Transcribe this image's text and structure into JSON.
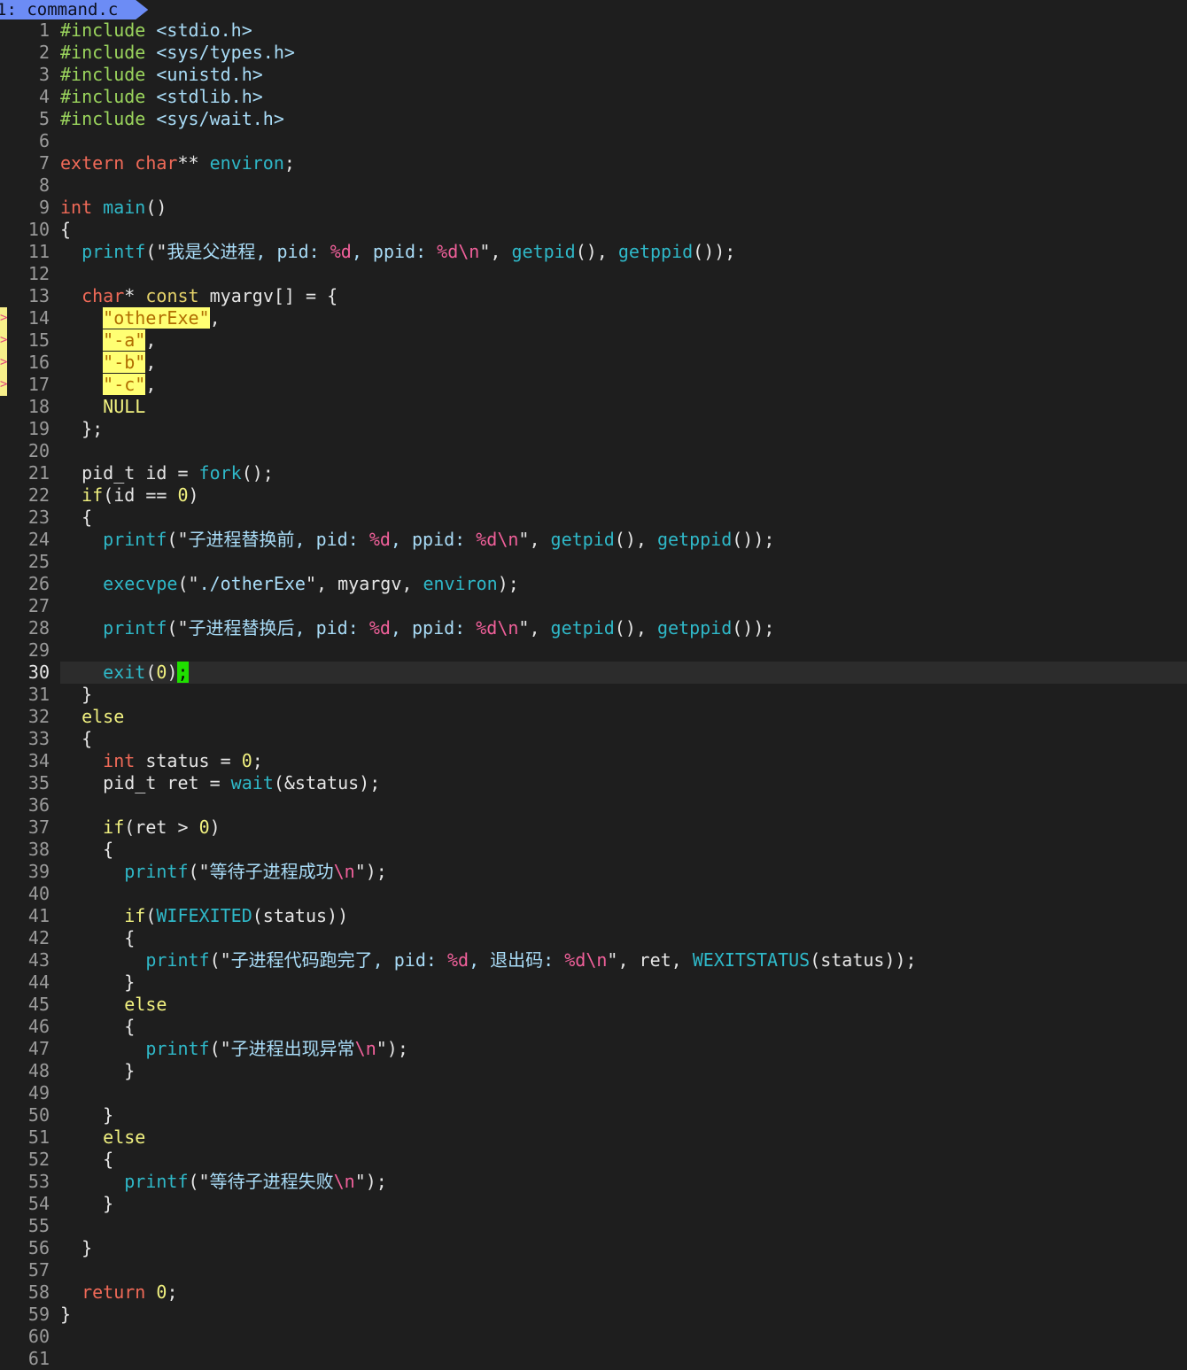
{
  "tab": {
    "label": "1: command.c"
  },
  "lines": [
    {
      "n": "1",
      "tokens": [
        [
          "#include",
          "p"
        ],
        [
          " ",
          ""
        ],
        [
          "<stdio.h>",
          "s"
        ]
      ]
    },
    {
      "n": "2",
      "tokens": [
        [
          "#include",
          "p"
        ],
        [
          " ",
          ""
        ],
        [
          "<sys/types.h>",
          "s"
        ]
      ]
    },
    {
      "n": "3",
      "tokens": [
        [
          "#include",
          "p"
        ],
        [
          " ",
          ""
        ],
        [
          "<unistd.h>",
          "s"
        ]
      ]
    },
    {
      "n": "4",
      "tokens": [
        [
          "#include",
          "p"
        ],
        [
          " ",
          ""
        ],
        [
          "<stdlib.h>",
          "s"
        ]
      ]
    },
    {
      "n": "5",
      "tokens": [
        [
          "#include",
          "p"
        ],
        [
          " ",
          ""
        ],
        [
          "<sys/wait.h>",
          "s"
        ]
      ]
    },
    {
      "n": "6",
      "tokens": []
    },
    {
      "n": "7",
      "tokens": [
        [
          "extern",
          "k"
        ],
        [
          " ",
          ""
        ],
        [
          "char",
          "k"
        ],
        [
          "** ",
          ""
        ],
        [
          "environ",
          "f"
        ],
        [
          ";",
          ""
        ]
      ]
    },
    {
      "n": "8",
      "tokens": []
    },
    {
      "n": "9",
      "tokens": [
        [
          "int",
          "k"
        ],
        [
          " ",
          ""
        ],
        [
          "main",
          "f"
        ],
        [
          "()",
          ""
        ]
      ]
    },
    {
      "n": "10",
      "tokens": [
        [
          "{",
          ""
        ]
      ]
    },
    {
      "n": "11",
      "tokens": [
        [
          "  ",
          ""
        ],
        [
          "printf",
          "f"
        ],
        [
          "(\"",
          ""
        ],
        [
          "我是父进程, pid: ",
          "s"
        ],
        [
          "%d",
          "e"
        ],
        [
          ", ppid: ",
          "s"
        ],
        [
          "%d\\n",
          "e"
        ],
        [
          "\", ",
          ""
        ],
        [
          "getpid",
          "f"
        ],
        [
          "(), ",
          ""
        ],
        [
          "getppid",
          "f"
        ],
        [
          "());",
          ""
        ]
      ]
    },
    {
      "n": "12",
      "tokens": []
    },
    {
      "n": "13",
      "tokens": [
        [
          "  ",
          ""
        ],
        [
          "char",
          "k"
        ],
        [
          "* ",
          ""
        ],
        [
          "const",
          "t"
        ],
        [
          " myargv[] = {",
          ""
        ]
      ]
    },
    {
      "n": "14",
      "sign": true,
      "tokens": [
        [
          "    ",
          ""
        ],
        [
          "\"otherExe\"",
          "hl"
        ],
        [
          ",",
          ""
        ]
      ]
    },
    {
      "n": "15",
      "sign": true,
      "tokens": [
        [
          "    ",
          ""
        ],
        [
          "\"-a\"",
          "hl"
        ],
        [
          ",",
          ""
        ]
      ]
    },
    {
      "n": "16",
      "sign": true,
      "tokens": [
        [
          "    ",
          ""
        ],
        [
          "\"-b\"",
          "hl"
        ],
        [
          ",",
          ""
        ]
      ]
    },
    {
      "n": "17",
      "sign": true,
      "tokens": [
        [
          "    ",
          ""
        ],
        [
          "\"-c\"",
          "hl"
        ],
        [
          ",",
          ""
        ]
      ]
    },
    {
      "n": "18",
      "tokens": [
        [
          "    ",
          ""
        ],
        [
          "NULL",
          "n"
        ]
      ]
    },
    {
      "n": "19",
      "tokens": [
        [
          "  };",
          ""
        ]
      ]
    },
    {
      "n": "20",
      "tokens": []
    },
    {
      "n": "21",
      "tokens": [
        [
          "  pid_t id = ",
          ""
        ],
        [
          "fork",
          "f"
        ],
        [
          "();",
          ""
        ]
      ]
    },
    {
      "n": "22",
      "tokens": [
        [
          "  ",
          ""
        ],
        [
          "if",
          "n"
        ],
        [
          "(id == ",
          ""
        ],
        [
          "0",
          "n"
        ],
        [
          ")",
          ""
        ]
      ]
    },
    {
      "n": "23",
      "tokens": [
        [
          "  {",
          ""
        ]
      ]
    },
    {
      "n": "24",
      "tokens": [
        [
          "    ",
          ""
        ],
        [
          "printf",
          "f"
        ],
        [
          "(\"",
          ""
        ],
        [
          "子进程替换前, pid: ",
          "s"
        ],
        [
          "%d",
          "e"
        ],
        [
          ", ppid: ",
          "s"
        ],
        [
          "%d\\n",
          "e"
        ],
        [
          "\", ",
          ""
        ],
        [
          "getpid",
          "f"
        ],
        [
          "(), ",
          ""
        ],
        [
          "getppid",
          "f"
        ],
        [
          "());",
          ""
        ]
      ]
    },
    {
      "n": "25",
      "tokens": []
    },
    {
      "n": "26",
      "tokens": [
        [
          "    ",
          ""
        ],
        [
          "execvpe",
          "f"
        ],
        [
          "(\"",
          ""
        ],
        [
          "./otherExe",
          "s"
        ],
        [
          "\", myargv, ",
          ""
        ],
        [
          "environ",
          "f"
        ],
        [
          ");",
          ""
        ]
      ]
    },
    {
      "n": "27",
      "tokens": []
    },
    {
      "n": "28",
      "tokens": [
        [
          "    ",
          ""
        ],
        [
          "printf",
          "f"
        ],
        [
          "(\"",
          ""
        ],
        [
          "子进程替换后, pid: ",
          "s"
        ],
        [
          "%d",
          "e"
        ],
        [
          ", ppid: ",
          "s"
        ],
        [
          "%d\\n",
          "e"
        ],
        [
          "\", ",
          ""
        ],
        [
          "getpid",
          "f"
        ],
        [
          "(), ",
          ""
        ],
        [
          "getppid",
          "f"
        ],
        [
          "());",
          ""
        ]
      ]
    },
    {
      "n": "29",
      "tokens": []
    },
    {
      "n": "30",
      "current": true,
      "tokens": [
        [
          "    ",
          ""
        ],
        [
          "exit",
          "f"
        ],
        [
          "(",
          ""
        ],
        [
          "0",
          "n"
        ],
        [
          ")",
          ""
        ],
        [
          ";",
          "cursor"
        ]
      ]
    },
    {
      "n": "31",
      "tokens": [
        [
          "  }",
          ""
        ]
      ]
    },
    {
      "n": "32",
      "tokens": [
        [
          "  ",
          ""
        ],
        [
          "else",
          "n"
        ]
      ]
    },
    {
      "n": "33",
      "tokens": [
        [
          "  {",
          ""
        ]
      ]
    },
    {
      "n": "34",
      "tokens": [
        [
          "    ",
          ""
        ],
        [
          "int",
          "k"
        ],
        [
          " status = ",
          ""
        ],
        [
          "0",
          "n"
        ],
        [
          ";",
          ""
        ]
      ]
    },
    {
      "n": "35",
      "tokens": [
        [
          "    pid_t ret = ",
          ""
        ],
        [
          "wait",
          "f"
        ],
        [
          "(&status);",
          ""
        ]
      ]
    },
    {
      "n": "36",
      "tokens": []
    },
    {
      "n": "37",
      "tokens": [
        [
          "    ",
          ""
        ],
        [
          "if",
          "n"
        ],
        [
          "(ret > ",
          ""
        ],
        [
          "0",
          "n"
        ],
        [
          ")",
          ""
        ]
      ]
    },
    {
      "n": "38",
      "tokens": [
        [
          "    {",
          ""
        ]
      ]
    },
    {
      "n": "39",
      "tokens": [
        [
          "      ",
          ""
        ],
        [
          "printf",
          "f"
        ],
        [
          "(\"",
          ""
        ],
        [
          "等待子进程成功",
          "s"
        ],
        [
          "\\n",
          "e"
        ],
        [
          "\");",
          ""
        ]
      ]
    },
    {
      "n": "40",
      "tokens": []
    },
    {
      "n": "41",
      "tokens": [
        [
          "      ",
          ""
        ],
        [
          "if",
          "n"
        ],
        [
          "(",
          ""
        ],
        [
          "WIFEXITED",
          "f"
        ],
        [
          "(status))",
          ""
        ]
      ]
    },
    {
      "n": "42",
      "tokens": [
        [
          "      {",
          ""
        ]
      ]
    },
    {
      "n": "43",
      "tokens": [
        [
          "        ",
          ""
        ],
        [
          "printf",
          "f"
        ],
        [
          "(\"",
          ""
        ],
        [
          "子进程代码跑完了, pid: ",
          "s"
        ],
        [
          "%d",
          "e"
        ],
        [
          ", 退出码: ",
          "s"
        ],
        [
          "%d\\n",
          "e"
        ],
        [
          "\", ret, ",
          ""
        ],
        [
          "WEXITSTATUS",
          "f"
        ],
        [
          "(status));",
          ""
        ]
      ]
    },
    {
      "n": "44",
      "tokens": [
        [
          "      }",
          ""
        ]
      ]
    },
    {
      "n": "45",
      "tokens": [
        [
          "      ",
          ""
        ],
        [
          "else",
          "n"
        ]
      ]
    },
    {
      "n": "46",
      "tokens": [
        [
          "      {",
          ""
        ]
      ]
    },
    {
      "n": "47",
      "tokens": [
        [
          "        ",
          ""
        ],
        [
          "printf",
          "f"
        ],
        [
          "(\"",
          ""
        ],
        [
          "子进程出现异常",
          "s"
        ],
        [
          "\\n",
          "e"
        ],
        [
          "\");",
          ""
        ]
      ]
    },
    {
      "n": "48",
      "tokens": [
        [
          "      }",
          ""
        ]
      ]
    },
    {
      "n": "49",
      "tokens": []
    },
    {
      "n": "50",
      "tokens": [
        [
          "    }",
          ""
        ]
      ]
    },
    {
      "n": "51",
      "tokens": [
        [
          "    ",
          ""
        ],
        [
          "else",
          "n"
        ]
      ]
    },
    {
      "n": "52",
      "tokens": [
        [
          "    {",
          ""
        ]
      ]
    },
    {
      "n": "53",
      "tokens": [
        [
          "      ",
          ""
        ],
        [
          "printf",
          "f"
        ],
        [
          "(\"",
          ""
        ],
        [
          "等待子进程失败",
          "s"
        ],
        [
          "\\n",
          "e"
        ],
        [
          "\");",
          ""
        ]
      ]
    },
    {
      "n": "54",
      "tokens": [
        [
          "    }",
          ""
        ]
      ]
    },
    {
      "n": "55",
      "tokens": []
    },
    {
      "n": "56",
      "tokens": [
        [
          "  }",
          ""
        ]
      ]
    },
    {
      "n": "57",
      "tokens": []
    },
    {
      "n": "58",
      "tokens": [
        [
          "  ",
          ""
        ],
        [
          "return",
          "k"
        ],
        [
          " ",
          ""
        ],
        [
          "0",
          "n"
        ],
        [
          ";",
          ""
        ]
      ]
    },
    {
      "n": "59",
      "tokens": [
        [
          "}",
          ""
        ]
      ]
    },
    {
      "n": "60",
      "tokens": []
    },
    {
      "n": "61",
      "tokens": []
    }
  ]
}
